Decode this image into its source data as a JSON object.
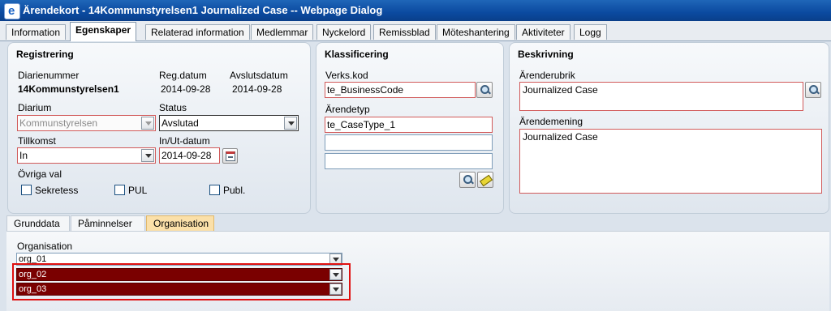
{
  "window": {
    "title": "Ärendekort - 14Kommunstyrelsen1 Journalized Case -- Webpage Dialog"
  },
  "tabs": [
    "Information",
    "Egenskaper",
    "Relaterad information",
    "Medlemmar",
    "Nyckelord",
    "Remissblad",
    "Möteshantering",
    "Aktiviteter",
    "Logg"
  ],
  "active_tab": "Egenskaper",
  "registrering": {
    "title": "Registrering",
    "diarienummer_label": "Diarienummer",
    "diarienummer": "14Kommunstyrelsen1",
    "regdatum_label": "Reg.datum",
    "regdatum": "2014-09-28",
    "avslutsdatum_label": "Avslutsdatum",
    "avslutsdatum": "2014-09-28",
    "diarium_label": "Diarium",
    "diarium": "Kommunstyrelsen",
    "status_label": "Status",
    "status": "Avslutad",
    "tillkomst_label": "Tillkomst",
    "tillkomst": "In",
    "inut_label": "In/Ut-datum",
    "inut": "2014-09-28",
    "ovriga_label": "Övriga val",
    "sekretess_label": "Sekretess",
    "pul_label": "PUL",
    "publ_label": "Publ."
  },
  "klassificering": {
    "title": "Klassificering",
    "verkskod_label": "Verks.kod",
    "verkskod": "te_BusinessCode",
    "arendetyp_label": "Ärendetyp",
    "arendetyp": "te_CaseType_1",
    "extra1": "",
    "extra2": ""
  },
  "beskrivning": {
    "title": "Beskrivning",
    "arenderubrik_label": "Ärenderubrik",
    "arenderubrik": "Journalized Case",
    "arendemening_label": "Ärendemening",
    "arendemening": "Journalized Case"
  },
  "subtabs": [
    "Grunddata",
    "Påminnelser",
    "Organisation"
  ],
  "active_subtab": "Organisation",
  "organisation": {
    "label": "Organisation",
    "rows": [
      "org_01",
      "org_02",
      "org_03"
    ]
  },
  "colors": {
    "titlebar": "#0b4aa0",
    "selected_row": "#7a0000",
    "required_border": "#d15a5a",
    "active_subtab": "#fbe0a9"
  }
}
